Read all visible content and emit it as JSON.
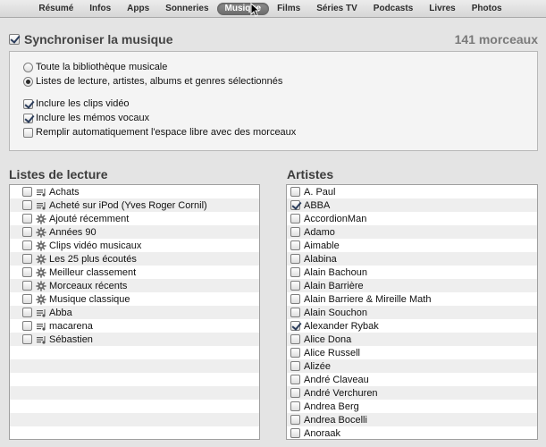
{
  "tabs": [
    "Résumé",
    "Infos",
    "Apps",
    "Sonneries",
    "Musique",
    "Films",
    "Séries TV",
    "Podcasts",
    "Livres",
    "Photos"
  ],
  "active_tab_index": 4,
  "sync": {
    "label": "Synchroniser la musique",
    "checked": true,
    "count": "141 morceaux"
  },
  "options": {
    "radio_all": "Toute la bibliothèque musicale",
    "radio_selected": "Listes de lecture, artistes, albums et genres sélectionnés",
    "selected_mode": "selected",
    "include_videos": {
      "label": "Inclure les clips vidéo",
      "checked": true
    },
    "include_memos": {
      "label": "Inclure les mémos vocaux",
      "checked": true
    },
    "fill_space": {
      "label": "Remplir automatiquement l'espace libre avec des morceaux",
      "checked": false
    }
  },
  "playlists": {
    "title": "Listes de lecture",
    "items": [
      {
        "label": "Achats",
        "icon": "playlist-icon",
        "checked": false
      },
      {
        "label": "Acheté sur iPod (Yves Roger Cornil)",
        "icon": "playlist-icon",
        "checked": false
      },
      {
        "label": "Ajouté récemment",
        "icon": "smart-playlist-icon",
        "checked": false
      },
      {
        "label": "Années 90",
        "icon": "smart-playlist-icon",
        "checked": false
      },
      {
        "label": "Clips vidéo musicaux",
        "icon": "smart-playlist-icon",
        "checked": false
      },
      {
        "label": "Les 25 plus écoutés",
        "icon": "smart-playlist-icon",
        "checked": false
      },
      {
        "label": "Meilleur classement",
        "icon": "smart-playlist-icon",
        "checked": false
      },
      {
        "label": "Morceaux récents",
        "icon": "smart-playlist-icon",
        "checked": false
      },
      {
        "label": "Musique classique",
        "icon": "smart-playlist-icon",
        "checked": false
      },
      {
        "label": "Abba",
        "icon": "playlist-icon",
        "checked": false
      },
      {
        "label": "macarena",
        "icon": "playlist-icon",
        "checked": false
      },
      {
        "label": "Sébastien",
        "icon": "playlist-icon",
        "checked": false
      }
    ]
  },
  "artists": {
    "title": "Artistes",
    "items": [
      {
        "label": "A. Paul",
        "checked": false
      },
      {
        "label": "ABBA",
        "checked": true
      },
      {
        "label": "AccordionMan",
        "checked": false
      },
      {
        "label": "Adamo",
        "checked": false
      },
      {
        "label": "Aimable",
        "checked": false
      },
      {
        "label": "Alabina",
        "checked": false
      },
      {
        "label": "Alain Bachoun",
        "checked": false
      },
      {
        "label": "Alain Barrière",
        "checked": false
      },
      {
        "label": "Alain Barriere & Mireille Math",
        "checked": false
      },
      {
        "label": "Alain Souchon",
        "checked": false
      },
      {
        "label": "Alexander Rybak",
        "checked": true
      },
      {
        "label": "Alice Dona",
        "checked": false
      },
      {
        "label": "Alice Russell",
        "checked": false
      },
      {
        "label": "Alizée",
        "checked": false
      },
      {
        "label": "André Claveau",
        "checked": false
      },
      {
        "label": "André Verchuren",
        "checked": false
      },
      {
        "label": "Andrea Berg",
        "checked": false
      },
      {
        "label": "Andrea Bocelli",
        "checked": false
      },
      {
        "label": "Anoraak",
        "checked": false
      }
    ]
  }
}
